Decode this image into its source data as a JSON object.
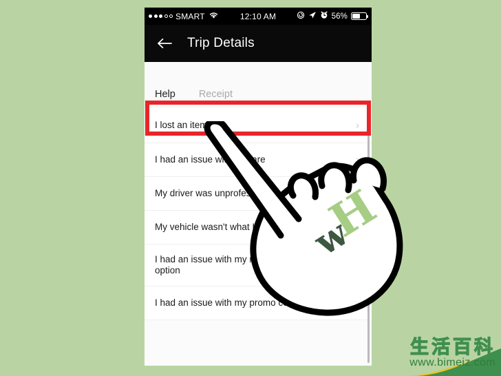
{
  "background_color": "#b9d4a2",
  "status_bar": {
    "signal_icon": "signal-dots-icon",
    "signal_bars_filled": 3,
    "signal_bars_total": 5,
    "carrier": "SMART",
    "wifi_icon": "wifi-icon",
    "time": "12:10 AM",
    "rotation_lock_icon": "rotation-lock-icon",
    "location_icon": "location-arrow-icon",
    "alarm_icon": "alarm-clock-icon",
    "battery_percent": "56%",
    "battery_icon": "battery-icon"
  },
  "nav_bar": {
    "back_icon": "back-arrow-icon",
    "title": "Trip Details",
    "background_color": "#0a0a0a"
  },
  "tabs": [
    {
      "label": "Help",
      "active": true
    },
    {
      "label": "Receipt",
      "active": false
    }
  ],
  "help_list": {
    "chevron_icon": "chevron-right-icon",
    "items": [
      {
        "label": "I lost an item",
        "highlighted": true
      },
      {
        "label": "I had an issue with my fare",
        "highlighted": false
      },
      {
        "label": "My driver was unprofessional",
        "highlighted": false
      },
      {
        "label": "My vehicle wasn't what I expected",
        "highlighted": false
      },
      {
        "label": "I had an issue with my receipt or payment option",
        "highlighted": false
      },
      {
        "label": "I had an issue with my promo code",
        "highlighted": false
      }
    ]
  },
  "highlight": {
    "color": "#e8252a",
    "target_item": "I lost an item"
  },
  "cursor": {
    "icon": "pointing-hand-cursor-icon",
    "logo_text_1": "w",
    "logo_text_2": "H",
    "logo_color_1": "#3d5840",
    "logo_color_2": "#a6cd84"
  },
  "watermark": {
    "characters": "生活百科",
    "url": "www.bimeiz.com",
    "color": "#2f7d3c",
    "ribbon_colors": [
      "#3f8f4f",
      "#e8c423"
    ]
  }
}
